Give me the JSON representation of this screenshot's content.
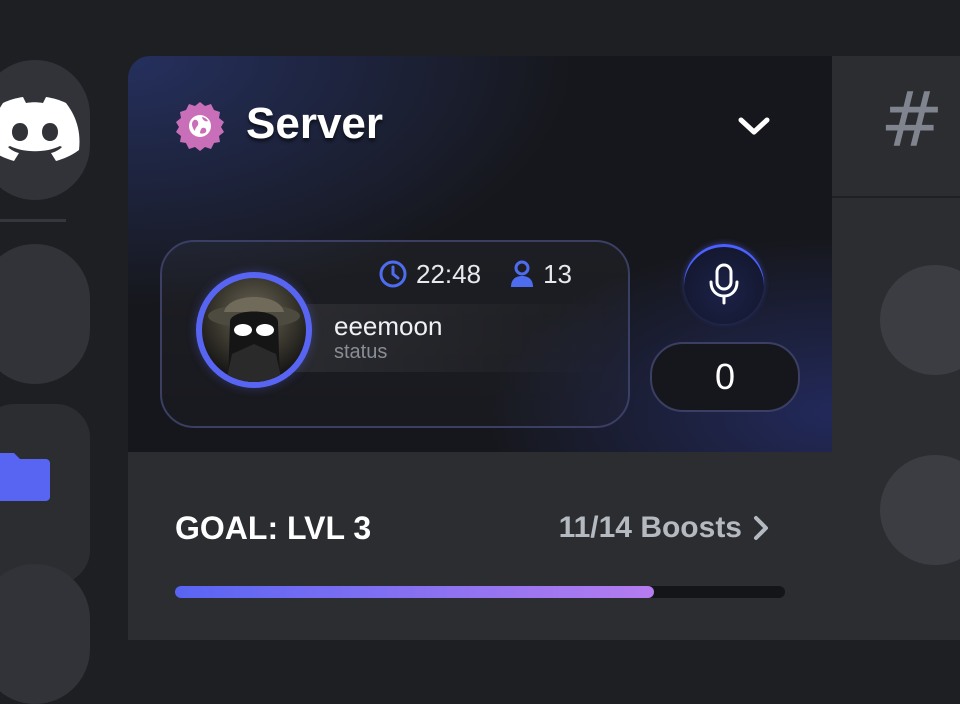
{
  "colors": {
    "brand": "#5865f2",
    "folder": "#5865f2",
    "badge": "#c96fb9",
    "progress_start": "#5865f2",
    "progress_end": "#b57cf0"
  },
  "rail": {
    "home_icon": "discord-logo-icon",
    "folder_icon": "folder-icon"
  },
  "channels": {
    "icon": "hash-icon",
    "hash_text": "#"
  },
  "server": {
    "name": "Server",
    "badge_icon": "globe-badge-icon",
    "dropdown_icon": "chevron-down-icon"
  },
  "voice": {
    "time": "22:48",
    "member_count": "13",
    "username": "eeemoon",
    "status": "status",
    "mic_icon": "microphone-icon",
    "counter": "0"
  },
  "boost": {
    "goal_label": "GOAL: LVL 3",
    "progress_text": "11/14 Boosts",
    "progress_fraction": 0.786
  }
}
